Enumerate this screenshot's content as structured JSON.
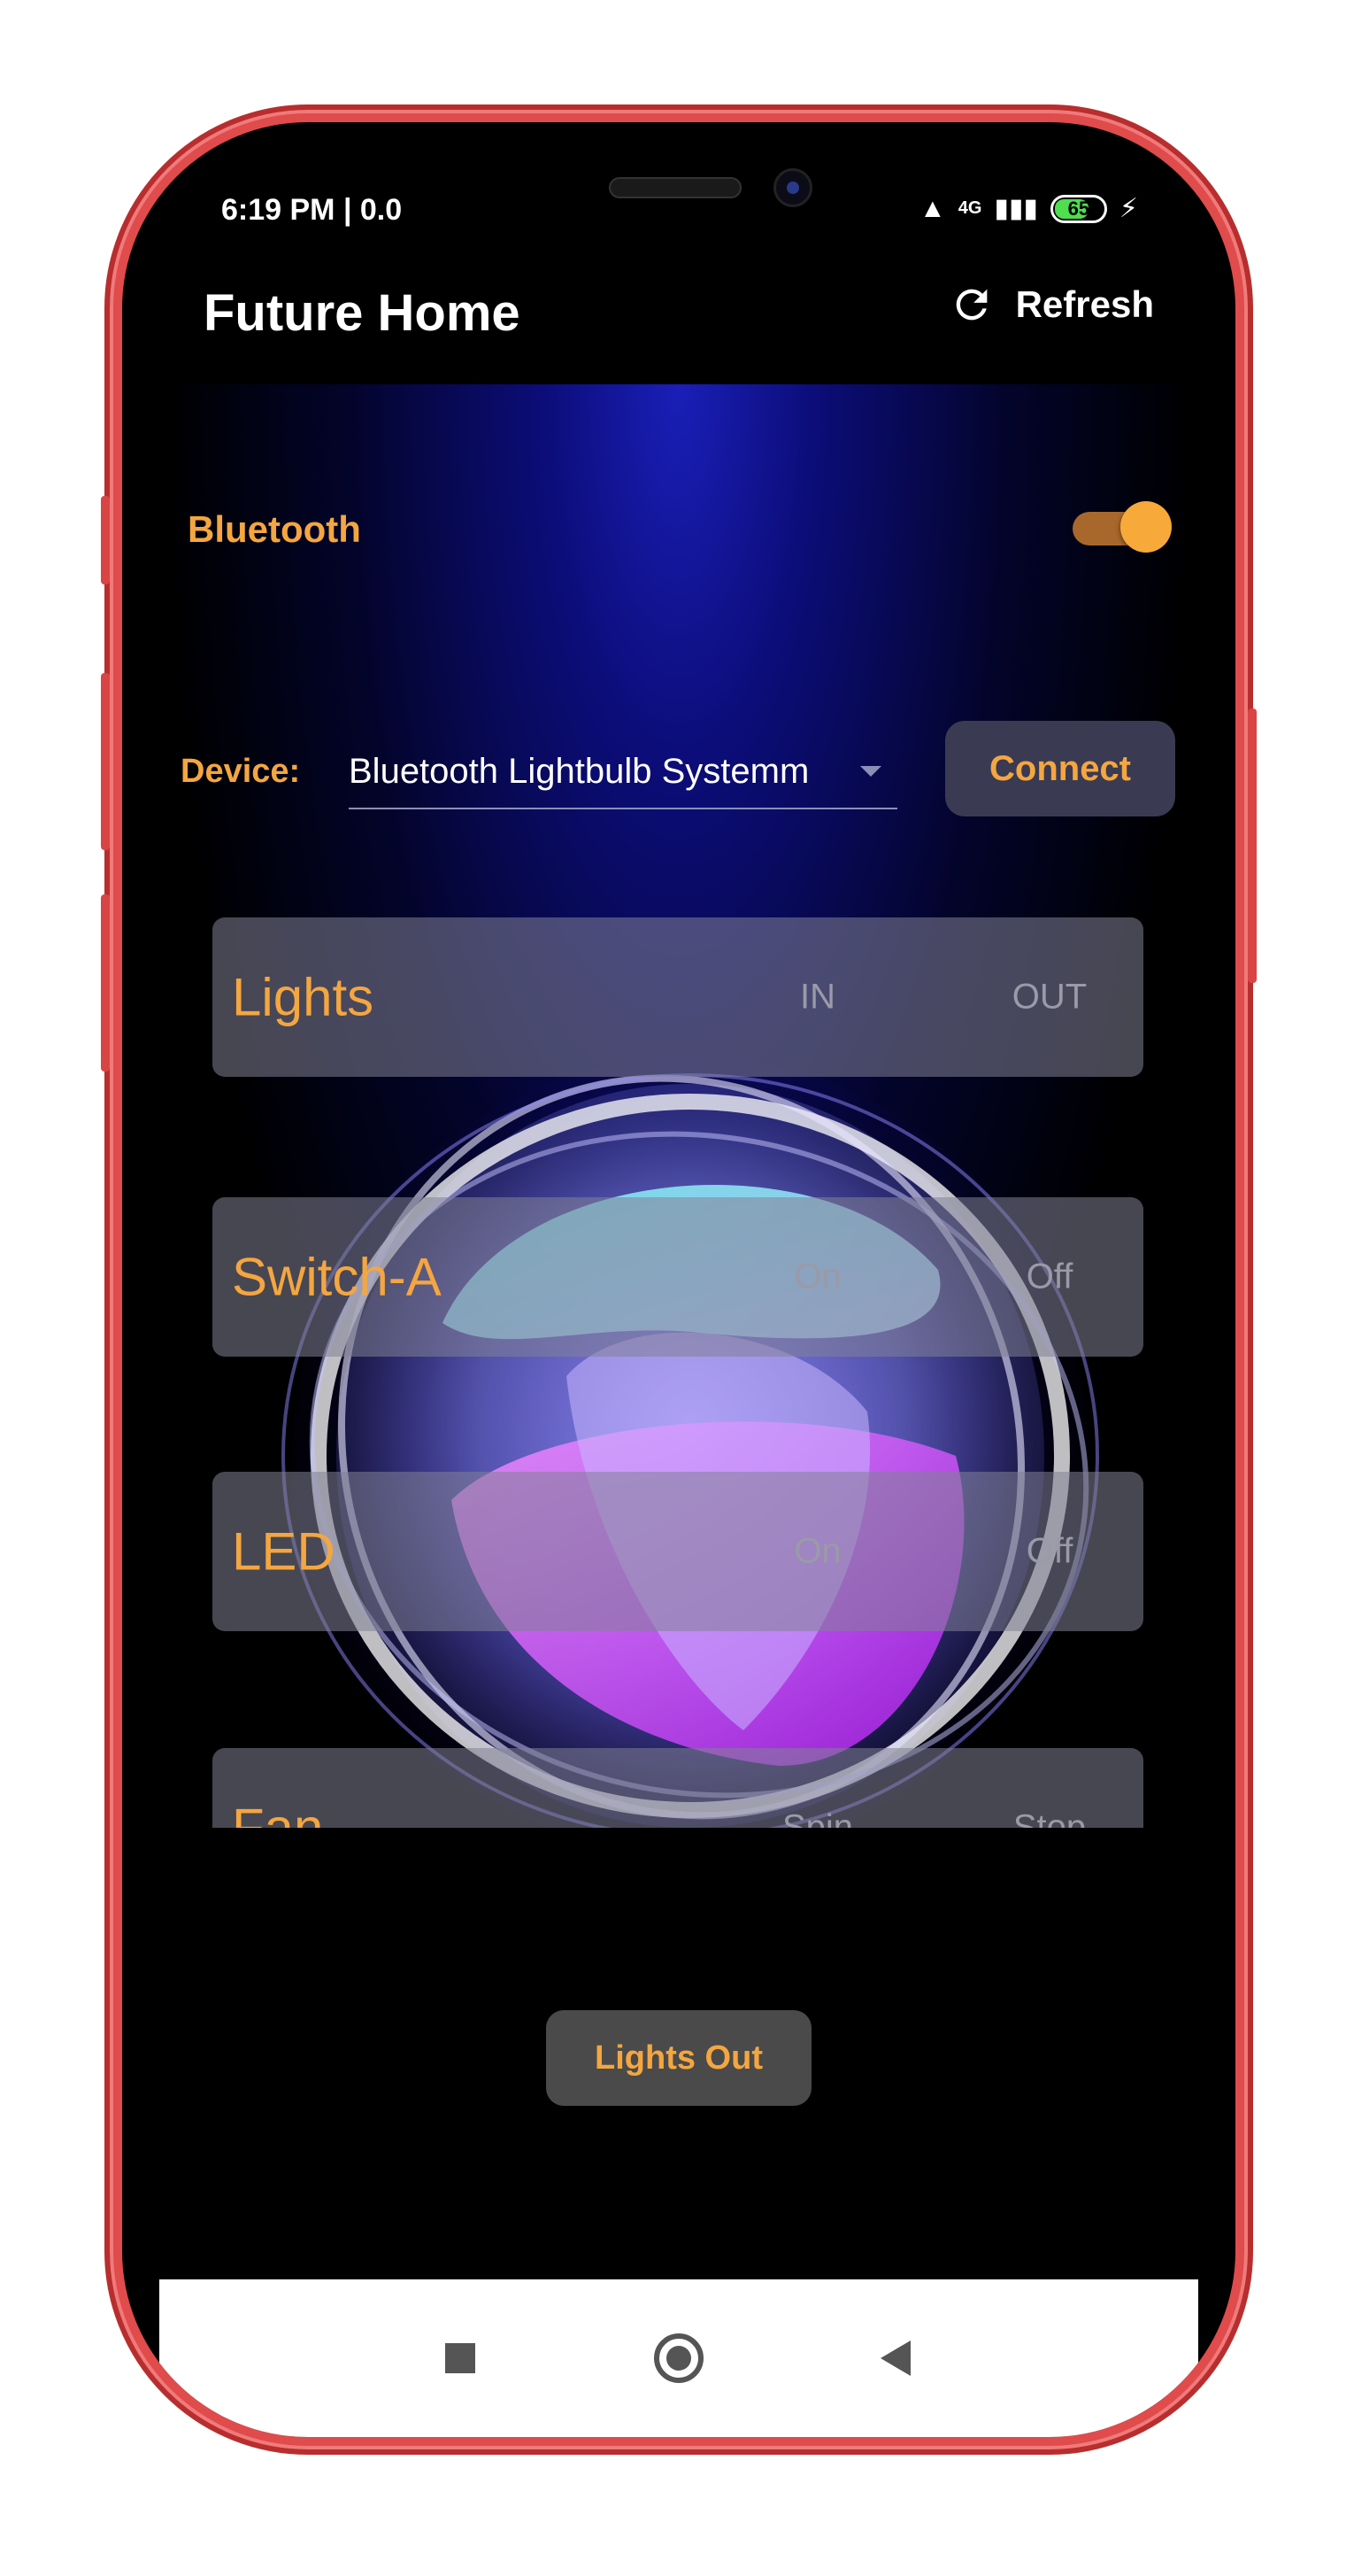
{
  "status_bar": {
    "time": "6:19 PM | 0.0",
    "network": "4G",
    "battery": "65"
  },
  "app_bar": {
    "title": "Future Home",
    "refresh_label": "Refresh"
  },
  "bluetooth": {
    "label": "Bluetooth",
    "enabled": true
  },
  "device": {
    "label": "Device:",
    "selected": "Bluetooth Lightbulb Systemm",
    "connect_label": "Connect"
  },
  "controls": [
    {
      "name": "Lights",
      "on_label": "IN",
      "off_label": "OUT"
    },
    {
      "name": "Switch-A",
      "on_label": "On",
      "off_label": "Off"
    },
    {
      "name": "LED",
      "on_label": "On",
      "off_label": "Off"
    },
    {
      "name": "Fan",
      "on_label": "Spin",
      "off_label": "Stop"
    }
  ],
  "lights_out_label": "Lights Out",
  "colors": {
    "accent": "#f4a640",
    "background": "#000000",
    "glow": "#1a1fb8"
  },
  "icons": {
    "refresh": "refresh-icon",
    "nav_recents": "square-icon",
    "nav_home": "circle-icon",
    "nav_back": "triangle-back-icon"
  }
}
